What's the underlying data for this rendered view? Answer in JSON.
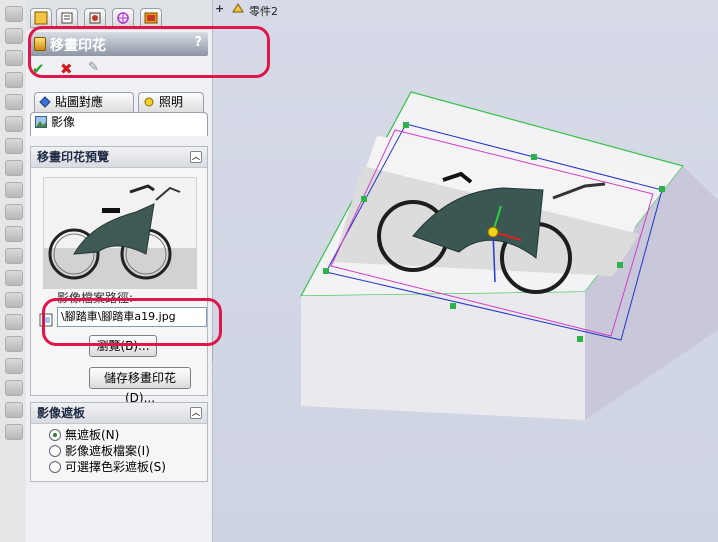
{
  "window": {
    "accent": "#e0154a"
  },
  "tree": {
    "expand": "+",
    "part_name": "零件2"
  },
  "property_manager": {
    "tab_icons": [
      "feature-manager-icon",
      "property-manager-icon",
      "configuration-manager-icon",
      "dim-expert-icon",
      "display-manager-icon"
    ],
    "title": "移畫印花",
    "help": "?",
    "ok_symbol": "✔",
    "cancel_symbol": "✖",
    "pin_symbol": "✎",
    "tabs": [
      {
        "label": "貼圖對應",
        "icon": "mapping-icon"
      },
      {
        "label": "照明",
        "icon": "lighting-icon"
      },
      {
        "label": "影像",
        "icon": "image-icon"
      }
    ],
    "preview_section": {
      "title": "移畫印花預覽",
      "path_label": "影像檔案路徑:",
      "path_value": "\\腳踏車\\腳踏車a19.jpg",
      "browse_label": "瀏覽(B)...",
      "save_label": "儲存移畫印花(D)..."
    },
    "mask_section": {
      "title": "影像遮板",
      "options": [
        {
          "label": "無遮板(N)",
          "selected": true
        },
        {
          "label": "影像遮板檔案(I)",
          "selected": false
        },
        {
          "label": "可選擇色彩遮板(S)",
          "selected": false
        }
      ]
    }
  }
}
